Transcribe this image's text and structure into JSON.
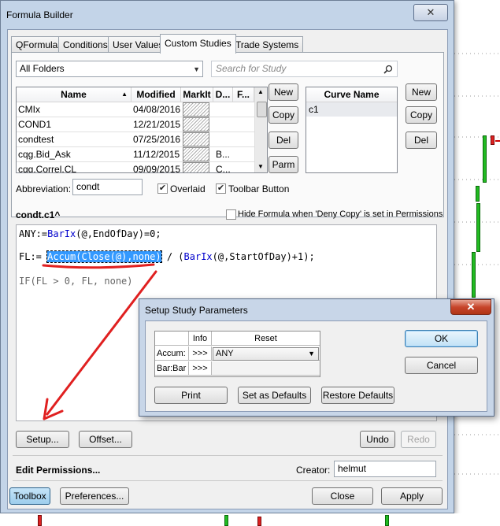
{
  "window": {
    "title": "Formula Builder",
    "close_glyph": "✕"
  },
  "tabs": [
    "QFormulas",
    "Conditions",
    "User Values",
    "Custom Studies",
    "Trade Systems"
  ],
  "active_tab": "Custom Studies",
  "folder_select": {
    "value": "All Folders"
  },
  "search": {
    "placeholder": "Search for Study"
  },
  "study_table": {
    "columns": [
      "Name",
      "Modified",
      "MarkIt",
      "D...",
      "F..."
    ],
    "rows": [
      {
        "name": "CMIx",
        "modified": "04/08/2016",
        "d": "",
        "f": ""
      },
      {
        "name": "COND1",
        "modified": "12/21/2015",
        "d": "",
        "f": ""
      },
      {
        "name": "condtest",
        "modified": "07/25/2016",
        "d": "",
        "f": ""
      },
      {
        "name": "cqg.Bid_Ask",
        "modified": "11/12/2015",
        "d": "B...",
        "f": ""
      },
      {
        "name": "cqg.Correl.CL",
        "modified": "09/09/2015",
        "d": "C...",
        "f": ""
      }
    ]
  },
  "study_buttons": [
    "New",
    "Copy",
    "Del",
    "Parm"
  ],
  "curve_list": {
    "header": "Curve Name",
    "items": [
      "c1"
    ]
  },
  "curve_buttons": [
    "New",
    "Copy",
    "Del"
  ],
  "abbreviation": {
    "label": "Abbreviation:",
    "value": "condt"
  },
  "overlaid": {
    "label": "Overlaid",
    "checked": true
  },
  "toolbar_button": {
    "label": "Toolbar Button",
    "checked": true
  },
  "formula_title": "condt.c1^",
  "hide_formula": {
    "label": "Hide Formula when 'Deny Copy' is set in Permissions",
    "checked": false
  },
  "code": {
    "line1_a": "ANY:=",
    "line1_b": "BarIx",
    "line1_c": "(@,EndOfDay)=0;",
    "line2_a": "FL:= ",
    "line2_hl": "Accum(Close(@),none)",
    "line2_b": " / (",
    "line2_c": "BarIx",
    "line2_d": "(@,StartOfDay)+1);",
    "line3": "IF(FL > 0, FL, none)"
  },
  "bottom_buttons": {
    "setup": "Setup...",
    "offset": "Offset...",
    "undo": "Undo",
    "redo": "Redo"
  },
  "edit_permissions": "Edit Permissions...",
  "creator": {
    "label": "Creator:",
    "value": "helmut"
  },
  "footer_buttons": {
    "toolbox": "Toolbox",
    "preferences": "Preferences...",
    "close": "Close",
    "apply": "Apply"
  },
  "dialog": {
    "title": "Setup Study Parameters",
    "close_glyph": "✕",
    "table_headers": [
      "Info",
      "Reset"
    ],
    "rows": [
      {
        "name": "Accum:",
        "info": ">>>",
        "reset": "ANY"
      },
      {
        "name": "Bar:Bar",
        "info": ">>>",
        "reset": ""
      }
    ],
    "buttons": {
      "ok": "OK",
      "cancel": "Cancel",
      "print": "Print",
      "defaults": "Set as Defaults",
      "restore": "Restore Defaults"
    }
  },
  "colors": {
    "annotation": "#e02020",
    "highlight": "#3399ff",
    "up_bar": "#22bb22",
    "down_bar": "#dd2222"
  }
}
